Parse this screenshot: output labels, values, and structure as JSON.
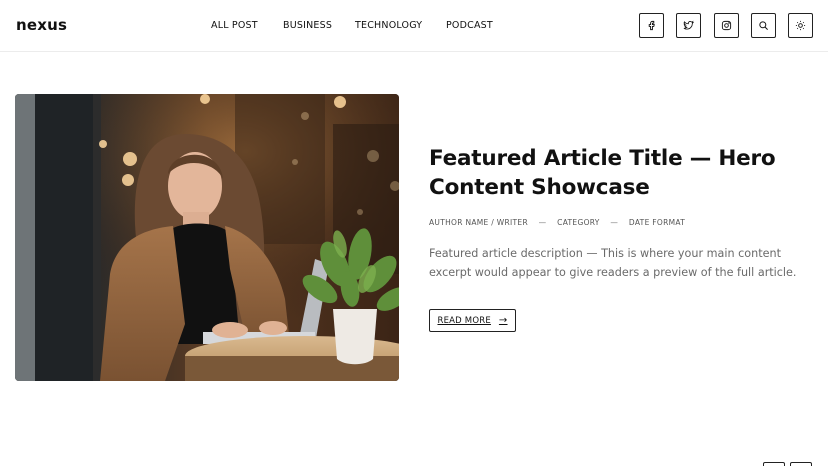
{
  "brand": {
    "logo": "nexus"
  },
  "nav": {
    "items": [
      "ALL POST",
      "BUSINESS",
      "TECHNOLOGY",
      "PODCAST"
    ]
  },
  "header_icons": [
    "facebook-icon",
    "twitter-icon",
    "instagram-icon",
    "search-icon",
    "sun-icon"
  ],
  "featured": {
    "title": "Featured Article Title — Hero Content Showcase",
    "meta": {
      "author": "AUTHOR NAME / WRITER",
      "category": "CATEGORY",
      "date": "DATE FORMAT",
      "separator": "—"
    },
    "description": "Featured article description — This is where your main content excerpt would appear to give readers a preview of the full article.",
    "read_more_label": "READ MORE",
    "read_more_arrow": "→"
  }
}
